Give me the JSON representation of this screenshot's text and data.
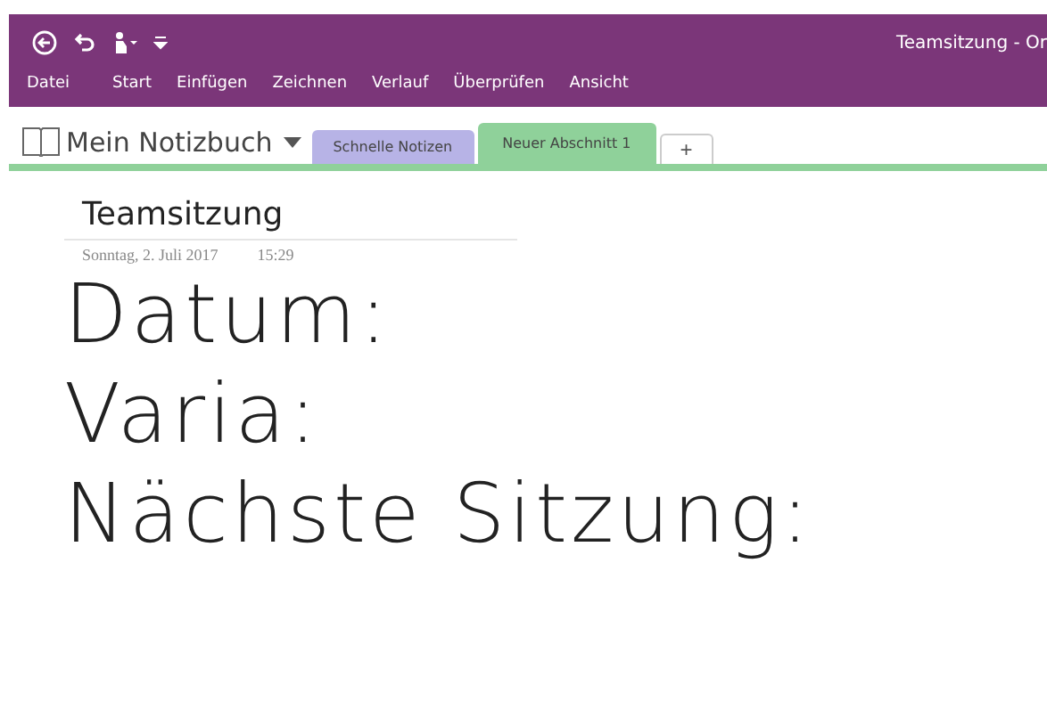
{
  "window": {
    "title": "Teamsitzung - Or"
  },
  "menu": [
    {
      "label": "Datei"
    },
    {
      "label": "Start"
    },
    {
      "label": "Einfügen"
    },
    {
      "label": "Zeichnen"
    },
    {
      "label": "Verlauf"
    },
    {
      "label": "Überprüfen"
    },
    {
      "label": "Ansicht"
    }
  ],
  "notebook": {
    "name": "Mein Notizbuch"
  },
  "sections": [
    {
      "label": "Schnelle Notizen",
      "selected": false,
      "color": "#b7b3e6"
    },
    {
      "label": "Neuer Abschnitt 1",
      "selected": true,
      "color": "#8fd19a"
    }
  ],
  "add_section": "+",
  "page": {
    "title": "Teamsitzung",
    "date": "Sonntag, 2. Juli 2017",
    "time": "15:29",
    "ink": [
      "Datum:",
      "Varia:",
      "Nächste Sitzung:"
    ]
  }
}
